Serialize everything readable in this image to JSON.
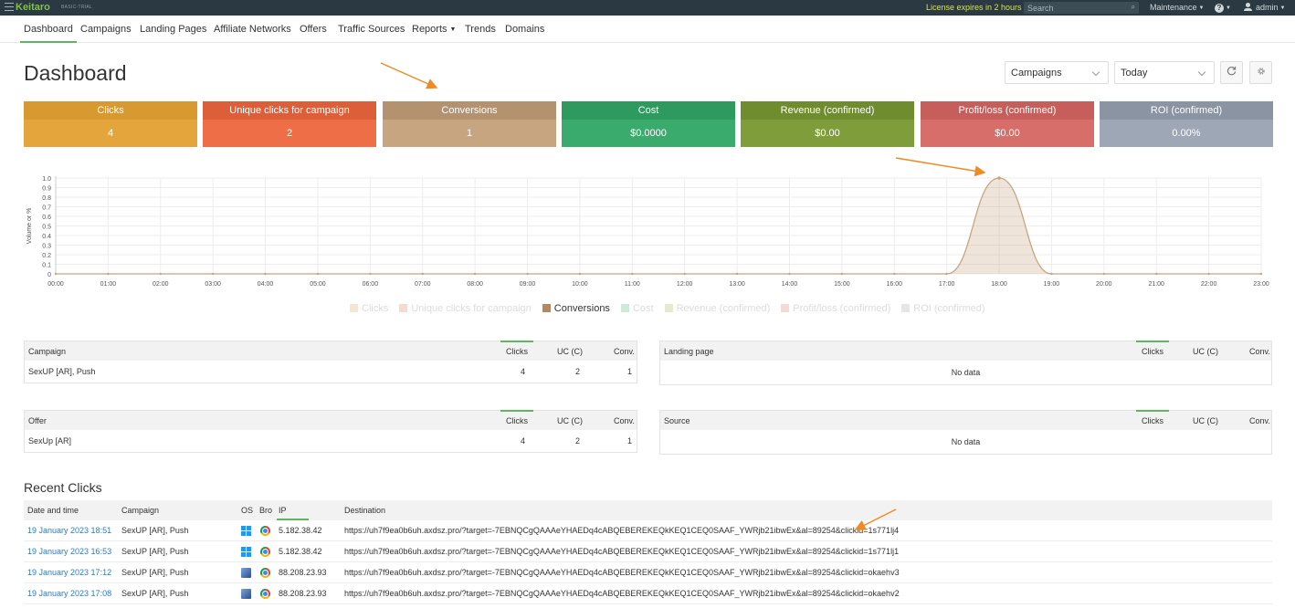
{
  "topbar": {
    "brand": "Keitaro",
    "plan": "BASIC-TRIAL",
    "license": "License expires in 2 hours",
    "search_placeholder": "Search",
    "maintenance": "Maintenance",
    "help": "?",
    "user": "admin"
  },
  "nav": [
    {
      "label": "Dashboard",
      "active": true
    },
    {
      "label": "Campaigns"
    },
    {
      "label": "Landing Pages"
    },
    {
      "label": "Affiliate Networks"
    },
    {
      "label": "Offers"
    },
    {
      "label": "Traffic Sources"
    },
    {
      "label": "Reports"
    },
    {
      "label": "Trends"
    },
    {
      "label": "Domains"
    }
  ],
  "header": {
    "title": "Dashboard",
    "group_select": "Campaigns",
    "period_select": "Today",
    "refresh_icon": "refresh-icon",
    "settings_icon": "gear-icon"
  },
  "cards": [
    {
      "title": "Clicks",
      "value": "4",
      "head": "#d89a30",
      "body": "#e4a63c"
    },
    {
      "title": "Unique clicks for campaign",
      "value": "2",
      "head": "#dd5f3a",
      "body": "#ee6e47"
    },
    {
      "title": "Conversions",
      "value": "1",
      "head": "#b49270",
      "body": "#c7a580"
    },
    {
      "title": "Cost",
      "value": "$0.0000",
      "head": "#2f9a5e",
      "body": "#3aab6c"
    },
    {
      "title": "Revenue (confirmed)",
      "value": "$0.00",
      "head": "#6f8d2e",
      "body": "#7f9d3a"
    },
    {
      "title": "Profit/loss (confirmed)",
      "value": "$0.00",
      "head": "#c65f5b",
      "body": "#d76e6a"
    },
    {
      "title": "ROI (confirmed)",
      "value": "0.00%",
      "head": "#8b94a3",
      "body": "#9ea7b5"
    }
  ],
  "chart_data": {
    "type": "area",
    "ylabel": "Volume or %",
    "ylim": [
      0,
      1.0
    ],
    "y_ticks": [
      "0",
      "0.1",
      "0.2",
      "0.3",
      "0.4",
      "0.5",
      "0.6",
      "0.7",
      "0.8",
      "0.9",
      "1.0"
    ],
    "x": [
      "00:00",
      "01:00",
      "02:00",
      "03:00",
      "04:00",
      "05:00",
      "06:00",
      "07:00",
      "08:00",
      "09:00",
      "10:00",
      "11:00",
      "12:00",
      "13:00",
      "14:00",
      "15:00",
      "16:00",
      "17:00",
      "18:00",
      "19:00",
      "20:00",
      "21:00",
      "22:00",
      "23:00"
    ],
    "series": [
      {
        "name": "Conversions",
        "values": [
          0,
          0,
          0,
          0,
          0,
          0,
          0,
          0,
          0,
          0,
          0,
          0,
          0,
          0,
          0,
          0,
          0,
          0,
          1,
          0,
          0,
          0,
          0,
          0
        ],
        "color": "#c7a580"
      }
    ],
    "legend": [
      {
        "name": "Clicks",
        "color": "#f6e6cf",
        "active": false
      },
      {
        "name": "Unique clicks for campaign",
        "color": "#f8d9cf",
        "active": false
      },
      {
        "name": "Conversions",
        "color": "#b08a65",
        "active": true
      },
      {
        "name": "Cost",
        "color": "#cfeadb",
        "active": false
      },
      {
        "name": "Revenue (confirmed)",
        "color": "#e4ebd0",
        "active": false
      },
      {
        "name": "Profit/loss (confirmed)",
        "color": "#f5d9d7",
        "active": false
      },
      {
        "name": "ROI (confirmed)",
        "color": "#e3e5e9",
        "active": false
      }
    ],
    "legend_position": "bottom",
    "grid": true
  },
  "tables": {
    "campaign": {
      "col": "Campaign",
      "clicks": "Clicks",
      "uc": "UC (C)",
      "conv": "Conv.",
      "rows": [
        {
          "name": "SexUP [AR], Push",
          "clicks": "4",
          "uc": "2",
          "conv": "1"
        }
      ]
    },
    "landing": {
      "col": "Landing page",
      "clicks": "Clicks",
      "uc": "UC (C)",
      "conv": "Conv.",
      "empty": "No data"
    },
    "offer": {
      "col": "Offer",
      "clicks": "Clicks",
      "uc": "UC (C)",
      "conv": "Conv.",
      "rows": [
        {
          "name": "SexUp [AR]",
          "clicks": "4",
          "uc": "2",
          "conv": "1"
        }
      ]
    },
    "source": {
      "col": "Source",
      "clicks": "Clicks",
      "uc": "UC (C)",
      "conv": "Conv.",
      "empty": "No data"
    }
  },
  "recent": {
    "title": "Recent Clicks",
    "headers": {
      "date": "Date and time",
      "campaign": "Campaign",
      "os": "OS",
      "bro": "Bro",
      "ip": "IP",
      "dest": "Destination"
    },
    "rows": [
      {
        "date": "19 January 2023 18:51",
        "campaign": "SexUP [AR], Push",
        "os": "windows-icon",
        "browser": "chrome-icon",
        "ip": "5.182.38.42",
        "dest": "https://uh7f9ea0b6uh.axdsz.pro/?target=-7EBNQCgQAAAeYHAEDq4cABQEBEREKEQkKEQ1CEQ0SAAF_YWRjb21ibwEx&al=89254&clickid=1s771lj4"
      },
      {
        "date": "19 January 2023 16:53",
        "campaign": "SexUP [AR], Push",
        "os": "windows-icon",
        "browser": "chrome-icon",
        "ip": "5.182.38.42",
        "dest": "https://uh7f9ea0b6uh.axdsz.pro/?target=-7EBNQCgQAAAeYHAEDq4cABQEBEREKEQkKEQ1CEQ0SAAF_YWRjb21ibwEx&al=89254&clickid=1s771lj1"
      },
      {
        "date": "19 January 2023 17:12",
        "campaign": "SexUP [AR], Push",
        "os": "mac-icon",
        "browser": "chrome-icon",
        "ip": "88.208.23.93",
        "dest": "https://uh7f9ea0b6uh.axdsz.pro/?target=-7EBNQCgQAAAeYHAEDq4cABQEBEREKEQkKEQ1CEQ0SAAF_YWRjb21ibwEx&al=89254&clickid=okaehv3"
      },
      {
        "date": "19 January 2023 17:08",
        "campaign": "SexUP [AR], Push",
        "os": "mac-icon",
        "browser": "chrome-icon",
        "ip": "88.208.23.93",
        "dest": "https://uh7f9ea0b6uh.axdsz.pro/?target=-7EBNQCgQAAAeYHAEDq4cABQEBEREKEQkKEQ1CEQ0SAAF_YWRjb21ibwEx&al=89254&clickid=okaehv2"
      }
    ]
  },
  "colors": {
    "accent": "#5cb85c",
    "annotation_arrow": "#f08a24",
    "link": "#2a7bc0"
  }
}
